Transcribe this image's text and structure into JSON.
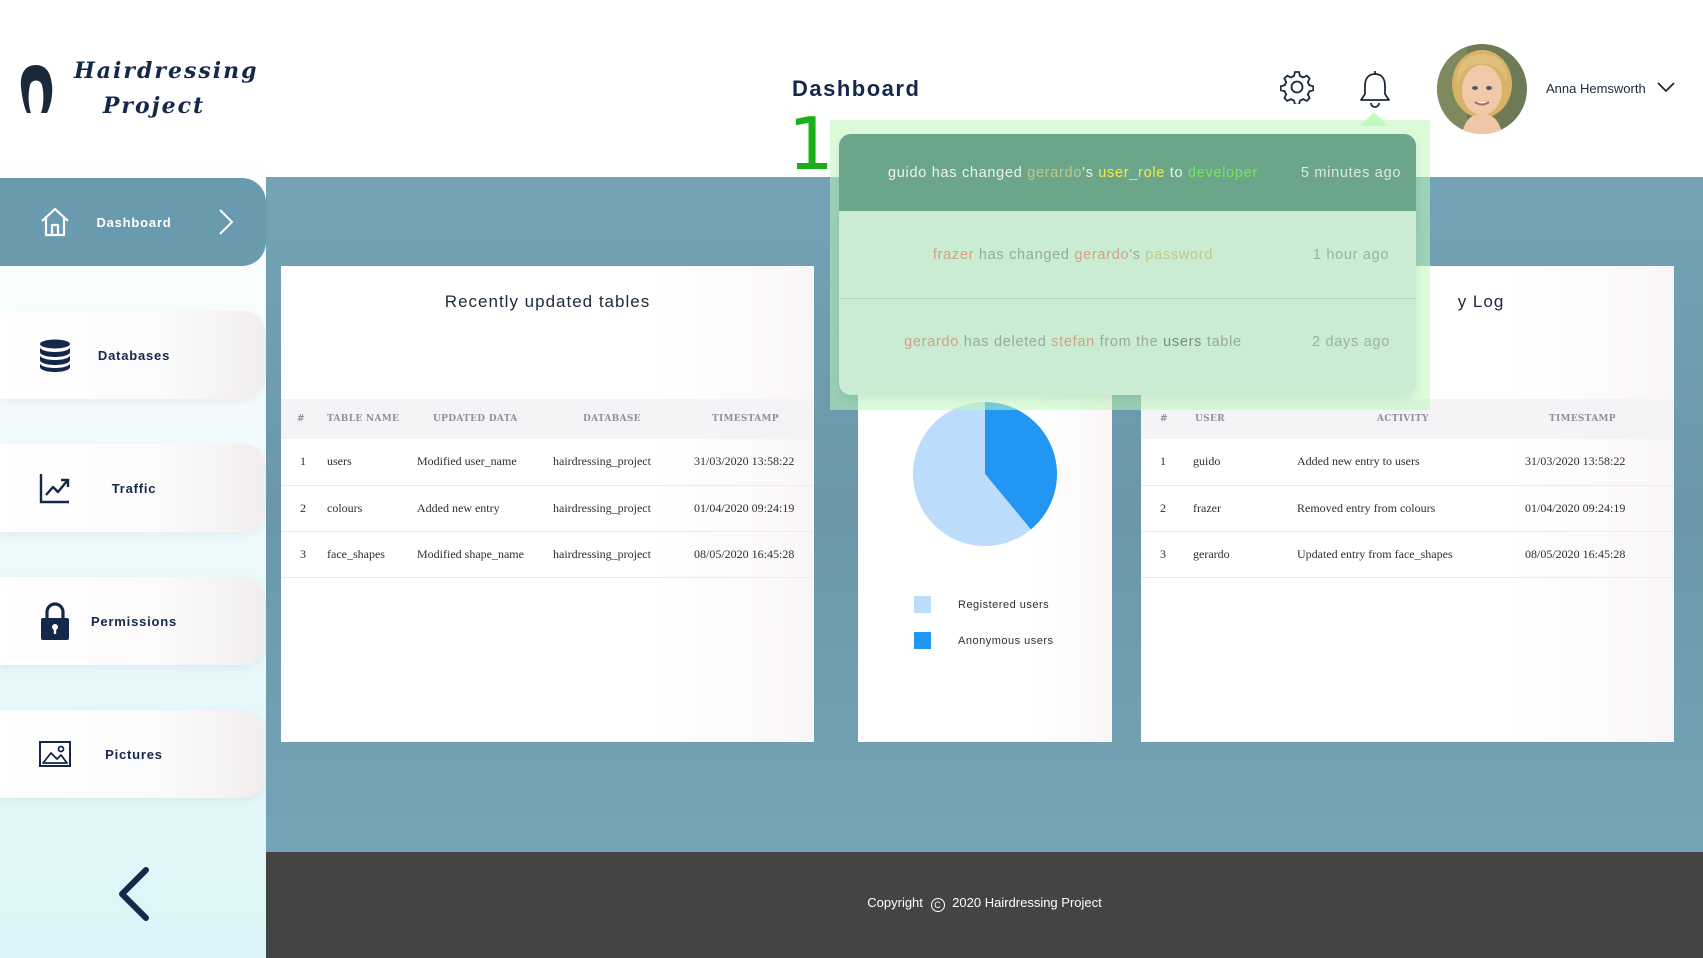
{
  "app": {
    "logo_line1": "Hairdressing",
    "logo_line2": "Project",
    "page_title": "Dashboard"
  },
  "header": {
    "user_name": "Anna Hemsworth",
    "notification_count": "1"
  },
  "sidebar": {
    "items": [
      {
        "label": "Dashboard",
        "icon": "home-icon",
        "active": true
      },
      {
        "label": "Databases",
        "icon": "database-icon"
      },
      {
        "label": "Traffic",
        "icon": "chart-line-icon"
      },
      {
        "label": "Permissions",
        "icon": "lock-icon"
      },
      {
        "label": "Pictures",
        "icon": "image-icon"
      }
    ]
  },
  "notifications": [
    {
      "actor": "guido",
      "verb": "has changed",
      "target": "gerardo",
      "possessive": "'s",
      "field": "user_role",
      "connector": "to",
      "value": "developer",
      "time": "5 minutes ago"
    },
    {
      "actor": "frazer",
      "verb": "has changed",
      "target": "gerardo",
      "possessive": "'s",
      "field": "password",
      "time": "1 hour ago"
    },
    {
      "actor": "gerardo",
      "verb": "has deleted",
      "target": "stefan",
      "tail_pre": "from the",
      "tail_obj": "users",
      "tail_post": "table",
      "time": "2 days ago"
    }
  ],
  "recent_tables": {
    "title": "Recently updated tables",
    "columns": [
      "#",
      "TABLE NAME",
      "UPDATED DATA",
      "DATABASE",
      "TIMESTAMP"
    ],
    "rows": [
      [
        "1",
        "users",
        "Modified user_name",
        "hairdressing_project",
        "31/03/2020 13:58:22"
      ],
      [
        "2",
        "colours",
        "Added new entry",
        "hairdressing_project",
        "01/04/2020 09:24:19"
      ],
      [
        "3",
        "face_shapes",
        "Modified shape_name",
        "hairdressing_project",
        "08/05/2020 16:45:28"
      ]
    ]
  },
  "activity_log": {
    "title_visible": "y Log",
    "columns": [
      "#",
      "USER",
      "ACTIVITY",
      "TIMESTAMP"
    ],
    "rows": [
      [
        "1",
        "guido",
        "Added new entry to users",
        "31/03/2020 13:58:22"
      ],
      [
        "2",
        "frazer",
        "Removed entry from colours",
        "01/04/2020 09:24:19"
      ],
      [
        "3",
        "gerardo",
        "Updated entry from face_shapes",
        "08/05/2020 16:45:28"
      ]
    ]
  },
  "chart_data": {
    "type": "pie",
    "title": "",
    "categories": [
      "Registered users",
      "Anonymous users"
    ],
    "values": [
      61,
      39
    ],
    "colors": [
      "#bbdcfb",
      "#2196f3"
    ],
    "legend": "bottom"
  },
  "footer": {
    "prefix": "Copyright",
    "copyright_symbol": "C",
    "text": "2020 Hairdressing Project"
  }
}
